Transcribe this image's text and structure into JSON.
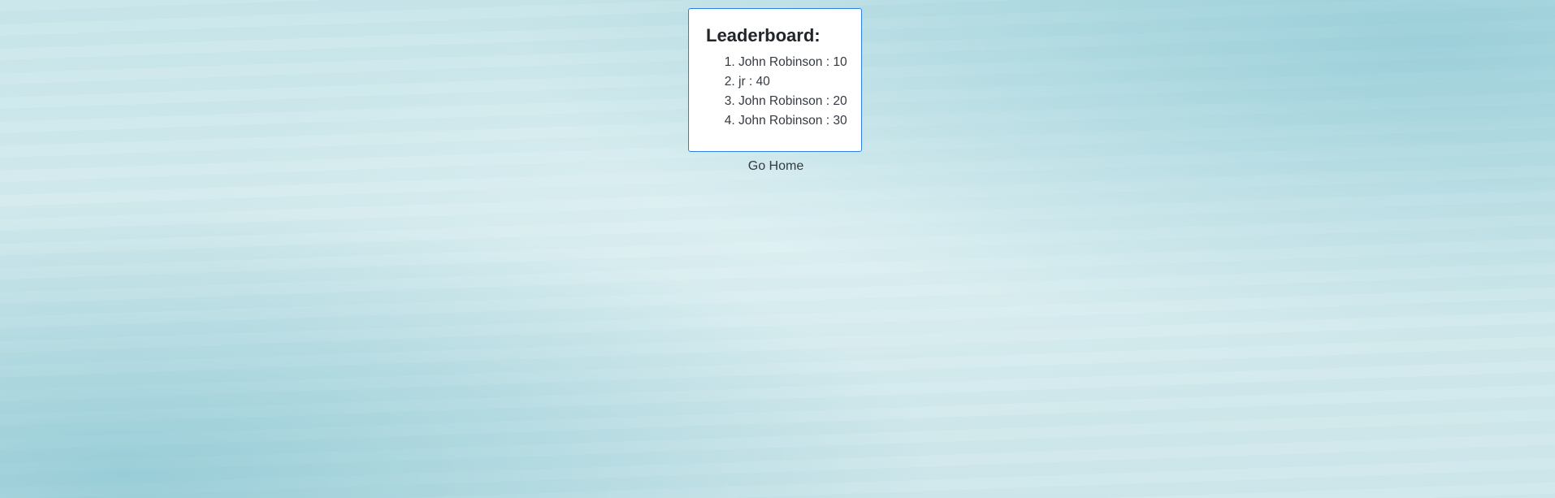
{
  "leaderboard": {
    "title": "Leaderboard:",
    "entries": [
      "John Robinson : 10",
      "jr : 40",
      "John Robinson : 20",
      "John Robinson : 30"
    ]
  },
  "nav": {
    "home_label": "Go Home"
  },
  "colors": {
    "card_border": "#2f7fe0",
    "background": "#cfe7eb"
  }
}
